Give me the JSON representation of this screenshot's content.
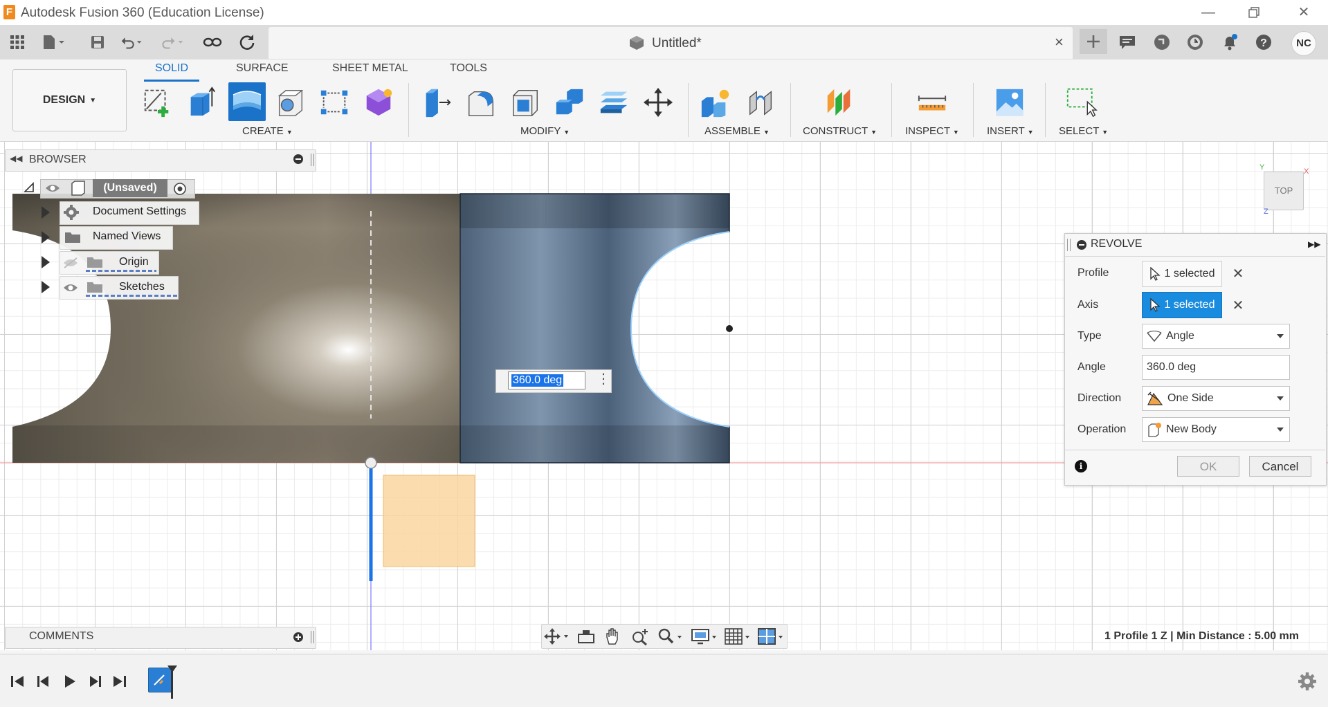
{
  "window": {
    "app_title": "Autodesk Fusion 360 (Education License)",
    "logo_letter": "F",
    "controls": [
      "minimize-icon",
      "restore-icon",
      "close-icon"
    ]
  },
  "document_tab": {
    "title": "Untitled*",
    "close_symbol": "×"
  },
  "quick_access": {
    "icons": [
      "apps-grid-icon",
      "file-icon",
      "save-icon",
      "undo-icon",
      "redo-icon",
      "link-icon",
      "refresh-icon"
    ],
    "right_icons": [
      "new-tab-icon",
      "chat-icon",
      "extensions-icon",
      "job-status-icon",
      "notifications-icon",
      "help-icon"
    ],
    "user_initials": "NC"
  },
  "ribbon": {
    "workspace": "DESIGN",
    "tabs": [
      {
        "label": "SOLID",
        "active": true
      },
      {
        "label": "SURFACE",
        "active": false
      },
      {
        "label": "SHEET METAL",
        "active": false
      },
      {
        "label": "TOOLS",
        "active": false
      }
    ],
    "groups": {
      "create": "CREATE",
      "modify": "MODIFY",
      "assemble": "ASSEMBLE",
      "construct": "CONSTRUCT",
      "inspect": "INSPECT",
      "insert": "INSERT",
      "select": "SELECT"
    },
    "accent_color": "#1a73c9"
  },
  "browser": {
    "title": "BROWSER",
    "root": "(Unsaved)",
    "items": [
      {
        "label": "Document Settings",
        "icon": "gear-icon"
      },
      {
        "label": "Named Views",
        "icon": "folder-icon"
      },
      {
        "label": "Origin",
        "icon": "folder-icon"
      },
      {
        "label": "Sketches",
        "icon": "folder-icon"
      }
    ]
  },
  "viewport": {
    "angle_input": "360.0 deg",
    "view_cube": "TOP",
    "axis_labels": {
      "x": "X",
      "y": "Y",
      "z": "Z"
    }
  },
  "revolve_dialog": {
    "title": "REVOLVE",
    "rows": [
      {
        "label": "Profile",
        "value": "1 selected"
      },
      {
        "label": "Axis",
        "value": "1 selected"
      },
      {
        "label": "Type",
        "value": "Angle"
      },
      {
        "label": "Angle",
        "value": "360.0 deg"
      },
      {
        "label": "Direction",
        "value": "One Side"
      },
      {
        "label": "Operation",
        "value": "New Body"
      }
    ],
    "ok": "OK",
    "cancel": "Cancel"
  },
  "comments": {
    "title": "COMMENTS"
  },
  "status": {
    "text": "1 Profile 1 Z | Min Distance : 5.00 mm"
  }
}
